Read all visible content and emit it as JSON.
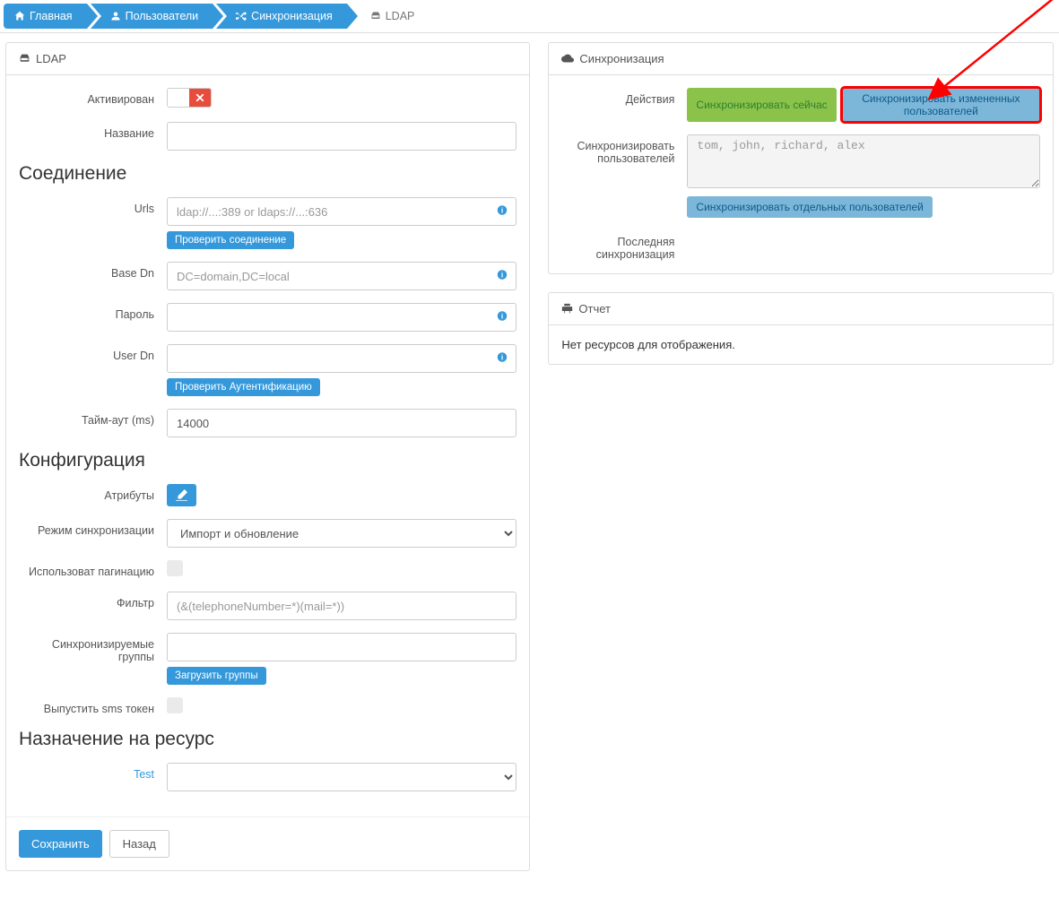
{
  "breadcrumb": {
    "home": "Главная",
    "users": "Пользователи",
    "sync": "Синхронизация",
    "ldap": "LDAP"
  },
  "leftPanel": {
    "title": "LDAP",
    "fields": {
      "activated": "Активирован",
      "name": "Название"
    },
    "connection": {
      "title": "Соединение",
      "urls": "Urls",
      "urls_ph": "ldap://...:389 or ldaps://...:636",
      "check_conn": "Проверить соединение",
      "basedn": "Base Dn",
      "basedn_ph": "DC=domain,DC=local",
      "password": "Пароль",
      "userdn": "User Dn",
      "check_auth": "Проверить Аутентификацию",
      "timeout": "Тайм-аут (ms)",
      "timeout_val": "14000"
    },
    "config": {
      "title": "Конфигурация",
      "attrs": "Атрибуты",
      "mode": "Режим синхронизации",
      "mode_opt": "Импорт и обновление",
      "pagination": "Использоват пагинацию",
      "filter": "Фильтр",
      "filter_ph": "(&(telephoneNumber=*)(mail=*))",
      "groups": "Синхронизируемые группы",
      "load_groups": "Загрузить группы",
      "sms_token": "Выпустить sms токен"
    },
    "assign": {
      "title": "Назначение на ресурс",
      "test": "Test"
    },
    "save": "Сохранить",
    "back": "Назад"
  },
  "rightSync": {
    "title": "Синхронизация",
    "actions": "Действия",
    "sync_now": "Синхронизировать сейчас",
    "sync_changed": "Синхронизировать измененных пользователей",
    "sync_users": "Синхронизировать пользователей",
    "users_ph": "tom, john, richard, alex",
    "sync_selected": "Синхронизировать отдельных пользователей",
    "last_sync": "Последняя синхронизация"
  },
  "report": {
    "title": "Отчет",
    "empty": "Нет ресурсов для отображения."
  }
}
